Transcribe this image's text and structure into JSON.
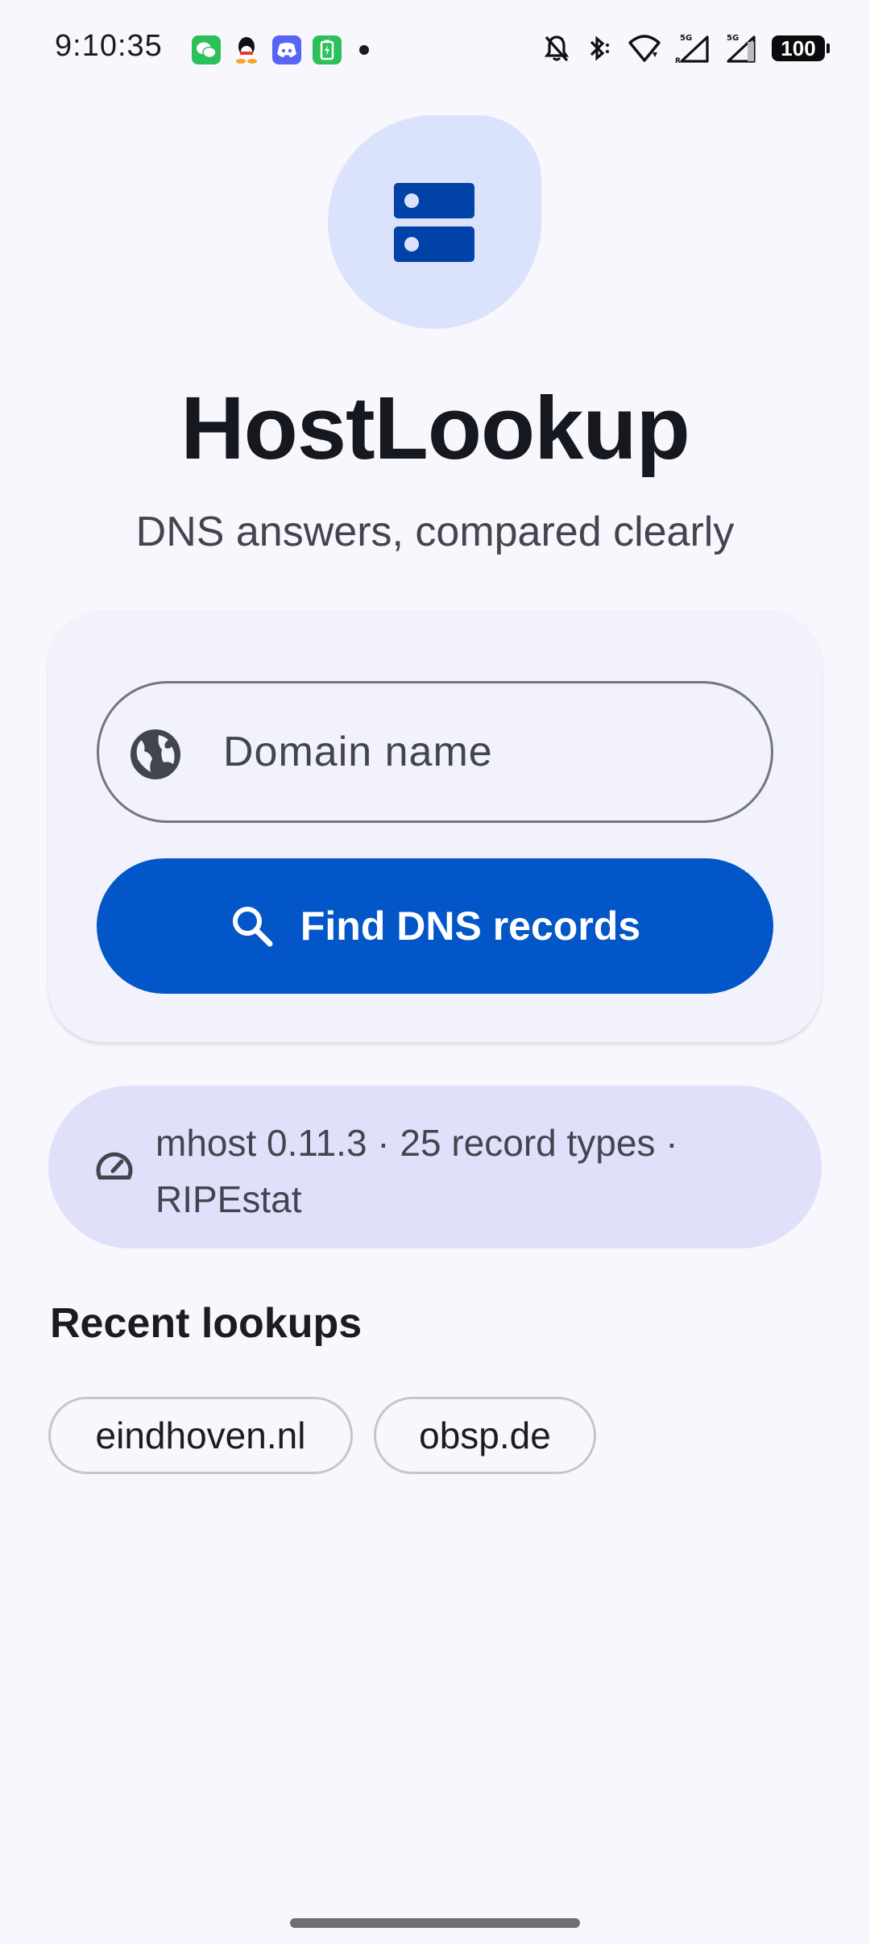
{
  "status_bar": {
    "time": "9:10:35",
    "battery": "100",
    "notification_icons": [
      "wechat-icon",
      "qq-icon",
      "discord-icon",
      "battery-saver-icon"
    ],
    "system_icons": [
      "mute-bell-icon",
      "bluetooth-icon",
      "wifi-icon",
      "cell-signal-5g-r-icon",
      "cell-signal-5g-icon"
    ],
    "network_label_1": "5G",
    "network_label_2": "5G"
  },
  "header": {
    "logo_icon": "dns-server-icon",
    "title": "HostLookup",
    "subtitle": "DNS answers, compared clearly"
  },
  "search": {
    "placeholder": "Domain name",
    "value": "",
    "leading_icon": "globe-icon",
    "button_icon": "search-icon",
    "button_label": "Find DNS records"
  },
  "info": {
    "icon": "speedometer-icon",
    "text": "mhost 0.11.3 · 25 record types · RIPEstat"
  },
  "recent": {
    "title": "Recent lookups",
    "items": [
      {
        "label": "eindhoven.nl"
      },
      {
        "label": "obsp.de"
      }
    ]
  },
  "colors": {
    "background": "#f7f7fd",
    "primary": "#0256c7",
    "logo_bg": "#dbe2fb",
    "logo_fg": "#0042a8",
    "info_bg": "#e1e0fa"
  }
}
